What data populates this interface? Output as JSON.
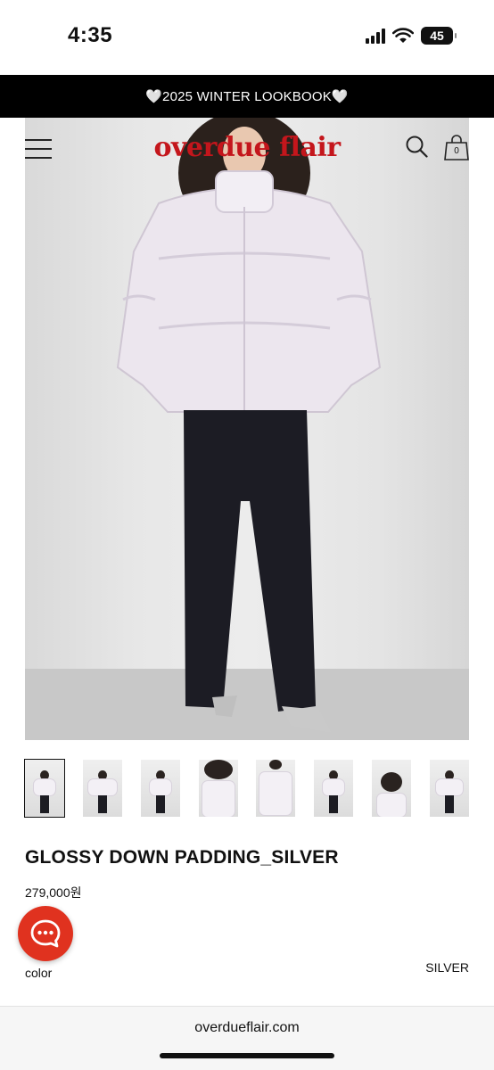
{
  "status_bar": {
    "time": "4:35",
    "battery": "45",
    "icons": [
      "signal-icon",
      "wifi-icon",
      "battery-icon"
    ]
  },
  "banner": {
    "text": "🤍2025 WINTER LOOKBOOK🤍"
  },
  "header": {
    "logo": "overdue flair",
    "bag_count": "0",
    "icons": [
      "menu-icon",
      "search-icon",
      "shopping-bag-icon"
    ],
    "logo_color": "#c4161c"
  },
  "product": {
    "title": "GLOSSY DOWN PADDING_SILVER",
    "price": "279,000원",
    "color_label": "color",
    "color_value": "SILVER",
    "thumbnail_count": 8
  },
  "chat": {
    "icon": "chat-bubble-icon",
    "color": "#e0321f"
  },
  "browser": {
    "url": "overdueflair.com"
  }
}
